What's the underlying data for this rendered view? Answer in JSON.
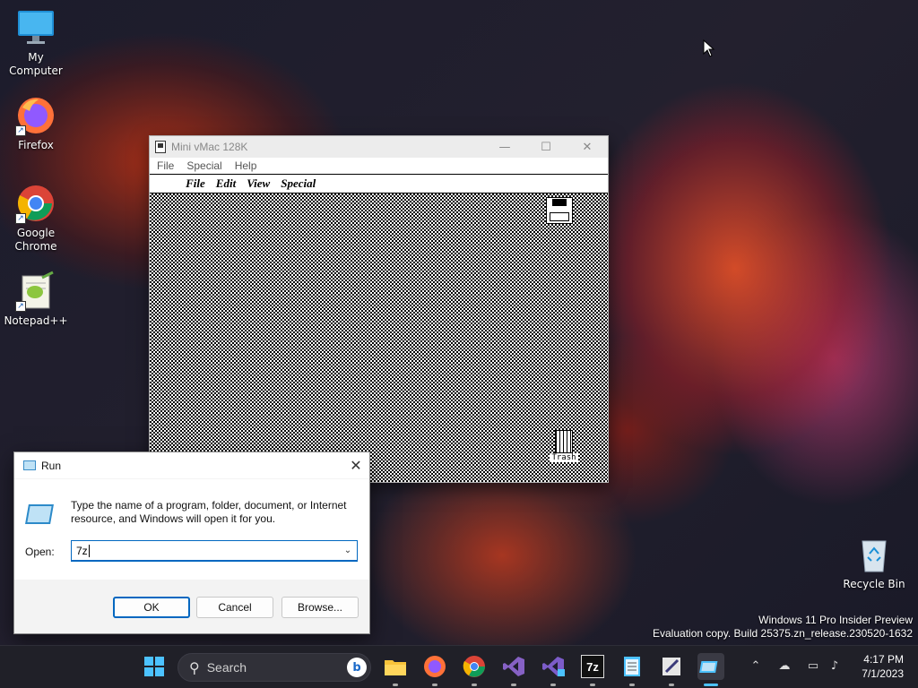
{
  "desktop_icons": [
    {
      "label": "My Computer"
    },
    {
      "label": "Firefox"
    },
    {
      "label": "Google Chrome"
    },
    {
      "label": "Notepad++"
    },
    {
      "label": "Recycle Bin"
    }
  ],
  "vmac": {
    "title": "Mini vMac 128K",
    "menu": [
      "File",
      "Special",
      "Help"
    ],
    "mac_menu": [
      "File",
      "Edit",
      "View",
      "Special"
    ],
    "apple_glyph": "",
    "trash_label": "Trash"
  },
  "run": {
    "title": "Run",
    "description": "Type the name of a program, folder, document, or Internet resource, and Windows will open it for you.",
    "open_label": "Open:",
    "open_value": "7z",
    "ok": "OK",
    "cancel": "Cancel",
    "browse": "Browse..."
  },
  "watermark": {
    "line1": "Windows 11 Pro Insider Preview",
    "line2": "Evaluation copy. Build 25375.zn_release.230520-1632"
  },
  "taskbar": {
    "search_placeholder": "Search",
    "time": "4:17 PM",
    "date": "7/1/2023",
    "sevenzip_label": "7z"
  }
}
